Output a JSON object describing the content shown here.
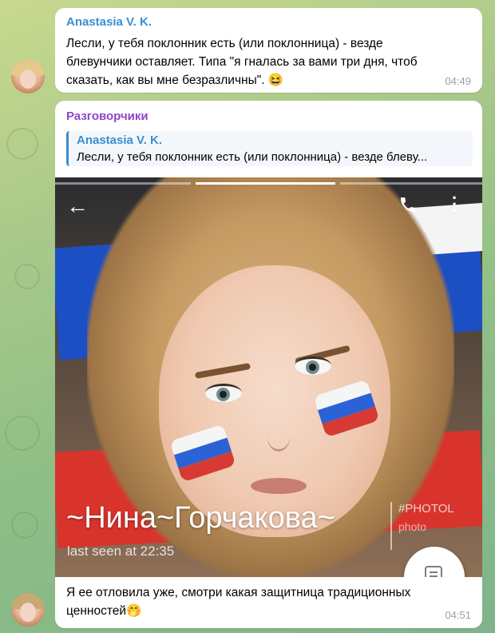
{
  "messages": [
    {
      "sender": "Anastasia V. K.",
      "text_lines": [
        "Лесли, у тебя поклонник есть (или поклонница) - везде",
        "блевунчики оставляет. Типа \"я гналась за вами три дня, чтоб",
        "сказать, как вы мне безразличны\". 😆"
      ],
      "time": "04:49"
    },
    {
      "sender": "Разговорчики",
      "reply": {
        "sender": "Anastasia V. K.",
        "text": "Лесли, у тебя поклонник есть (или поклонница) - везде блеву..."
      },
      "photo": {
        "name": "~Нина~Горчакова~",
        "status": "last seen at 22:35",
        "watermark_line1": "#PHOTOL",
        "watermark_line2": "photo"
      },
      "text_lines": [
        "Я ее отловила уже,  смотри какая защитница традиционных",
        "ценностей🤭"
      ],
      "time": "04:51"
    }
  ],
  "colors": {
    "sender1": "#3a8fd0",
    "sender2": "#8e45c8",
    "time": "#9aa1a6"
  },
  "icons": {
    "back": "arrow-left-icon",
    "call": "phone-icon",
    "menu": "more-vertical-icon",
    "fab": "message-icon"
  }
}
